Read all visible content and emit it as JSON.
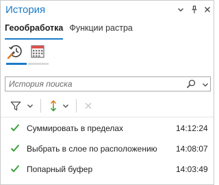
{
  "pane": {
    "title": "История",
    "title_color": "#1a7ac7",
    "buttons": [
      "menu-chevron-icon",
      "pin-icon",
      "close-icon"
    ]
  },
  "tabs": [
    {
      "label": "Геообработка",
      "active": true
    },
    {
      "label": "Функции растра",
      "active": false
    }
  ],
  "icon_tabs": [
    {
      "icon": "history-clock-icon",
      "active": true
    },
    {
      "icon": "calendar-icon",
      "active": false
    }
  ],
  "search": {
    "placeholder": "История поиска",
    "value": ""
  },
  "toolbar": {
    "items": [
      "filter-icon",
      "chevron-down-icon",
      "sort-icon",
      "chevron-down-icon",
      "delete-x-icon"
    ]
  },
  "history": {
    "items": [
      {
        "name": "Суммировать в пределах",
        "time": "14:12:24",
        "status": "success"
      },
      {
        "name": "Выбрать в слое по расположению",
        "time": "14:08:07",
        "status": "success"
      },
      {
        "name": "Попарный буфер",
        "time": "14:03:49",
        "status": "success"
      }
    ]
  },
  "colors": {
    "accent": "#1a7ac7",
    "success": "#3aa03a",
    "sort_orange": "#e07b1f",
    "sort_green": "#3aa03a",
    "disabled": "#c8c8c8"
  }
}
